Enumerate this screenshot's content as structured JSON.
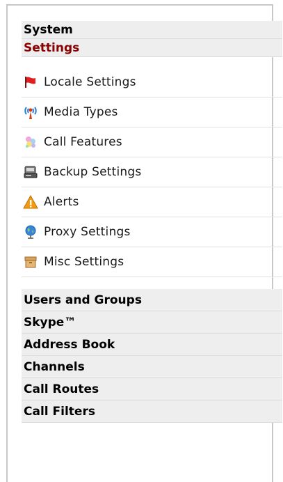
{
  "nav": {
    "top_sections": [
      {
        "label": "System"
      },
      {
        "label": "Settings"
      }
    ],
    "settings_items": [
      {
        "label": "Locale Settings",
        "icon": "red-flag-icon"
      },
      {
        "label": "Media Types",
        "icon": "antenna-icon"
      },
      {
        "label": "Call Features",
        "icon": "sparkle-icon"
      },
      {
        "label": "Backup Settings",
        "icon": "backup-drive-icon"
      },
      {
        "label": "Alerts",
        "icon": "warning-icon"
      },
      {
        "label": "Proxy Settings",
        "icon": "globe-icon"
      },
      {
        "label": "Misc Settings",
        "icon": "box-icon"
      }
    ],
    "bottom_sections": [
      {
        "label": "Users and Groups"
      },
      {
        "label": "Skype™"
      },
      {
        "label": "Address Book"
      },
      {
        "label": "Channels"
      },
      {
        "label": "Call Routes"
      },
      {
        "label": "Call Filters"
      }
    ]
  },
  "colors": {
    "active_header": "#8b0000",
    "header_bg": "#eeeeee",
    "frame_border": "#c8c8c8"
  }
}
